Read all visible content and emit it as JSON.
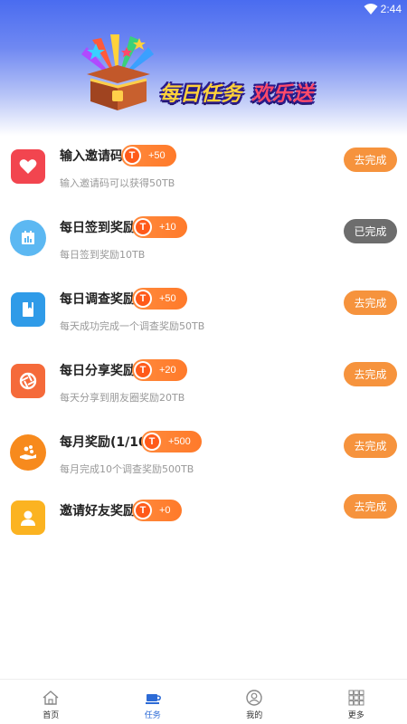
{
  "status_bar": {
    "time": "2:44"
  },
  "banner": {
    "title_part1": "每日任务",
    "title_part2": "欢乐送"
  },
  "tasks": [
    {
      "title": "输入邀请码",
      "reward": "+50",
      "desc": "输入邀请码可以获得50TB",
      "action": "去完成",
      "status": "pending",
      "icon": "heart-icon"
    },
    {
      "title": "每日签到奖励",
      "reward": "+10",
      "desc": "每日签到奖励10TB",
      "action": "已完成",
      "status": "done",
      "icon": "calendar-icon"
    },
    {
      "title": "每日调查奖励",
      "reward": "+50",
      "desc": "每天成功完成一个调查奖励50TB",
      "action": "去完成",
      "status": "pending",
      "icon": "book-icon"
    },
    {
      "title": "每日分享奖励",
      "reward": "+20",
      "desc": "每天分享到朋友圈奖励20TB",
      "action": "去完成",
      "status": "pending",
      "icon": "share-icon"
    },
    {
      "title": "每月奖励(1/10)",
      "reward": "+500",
      "desc": "每月完成10个调查奖励500TB",
      "action": "去完成",
      "status": "pending",
      "icon": "coins-hand-icon"
    },
    {
      "title": "邀请好友奖励",
      "reward": "+0",
      "desc": "",
      "action": "去完成",
      "status": "pending",
      "icon": "user-icon"
    }
  ],
  "reward_badge_letter": "T",
  "nav": [
    {
      "label": "首页",
      "icon": "home-icon",
      "active": false
    },
    {
      "label": "任务",
      "icon": "task-icon",
      "active": true
    },
    {
      "label": "我的",
      "icon": "profile-icon",
      "active": false
    },
    {
      "label": "更多",
      "icon": "grid-icon",
      "active": false
    }
  ],
  "colors": {
    "accent_orange": "#f6933d",
    "done_gray": "#6d6d6d",
    "nav_active": "#2d6bd6"
  }
}
